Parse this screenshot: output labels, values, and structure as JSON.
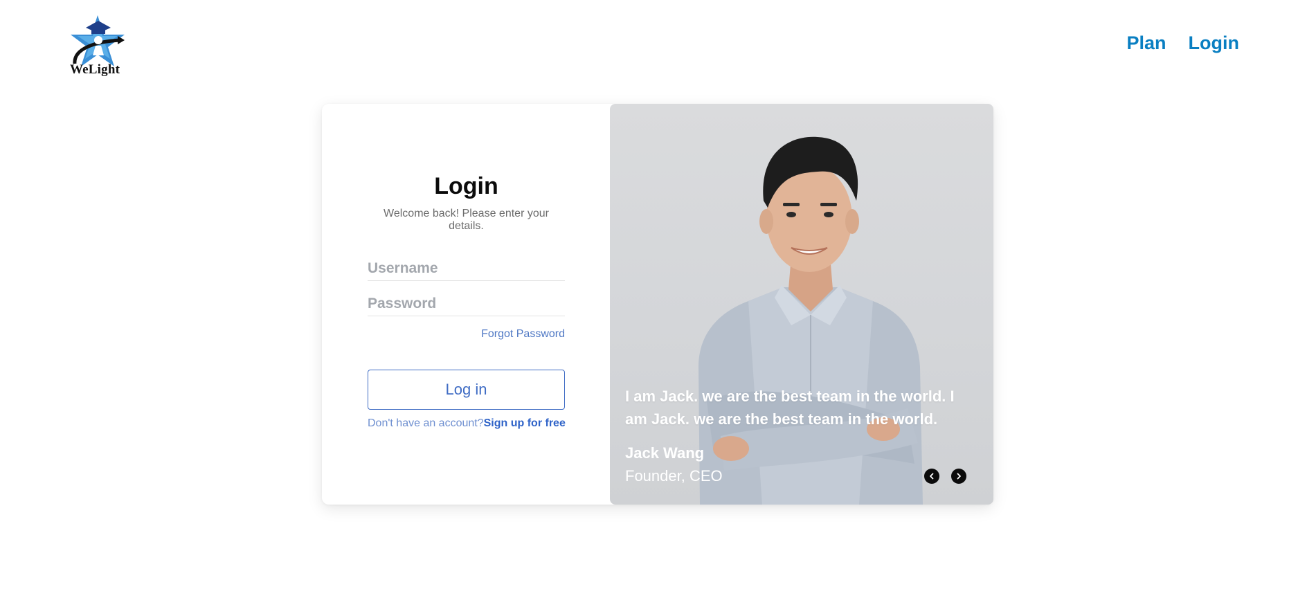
{
  "header": {
    "brand": "WeLight",
    "nav": [
      {
        "label": "Plan"
      },
      {
        "label": "Login"
      }
    ]
  },
  "login_form": {
    "title": "Login",
    "subtitle": "Welcome back! Please enter your details.",
    "username_placeholder": "Username",
    "password_placeholder": "Password",
    "forgot_password": "Forgot Password",
    "submit_label": "Log in",
    "signup_prompt": "Don't have an account?",
    "signup_link": "Sign up for free"
  },
  "testimonial": {
    "quote": "I am Jack. we are the best team in the world. I am Jack. we are the best team in the world.",
    "name": "Jack Wang",
    "role": "Founder, CEO",
    "prev_icon": "chevron-left-icon",
    "next_icon": "chevron-right-icon"
  },
  "colors": {
    "nav_link": "#0a7fc2",
    "button_accent": "#3f6cc4",
    "logo_blue": "#3a8fd6"
  }
}
